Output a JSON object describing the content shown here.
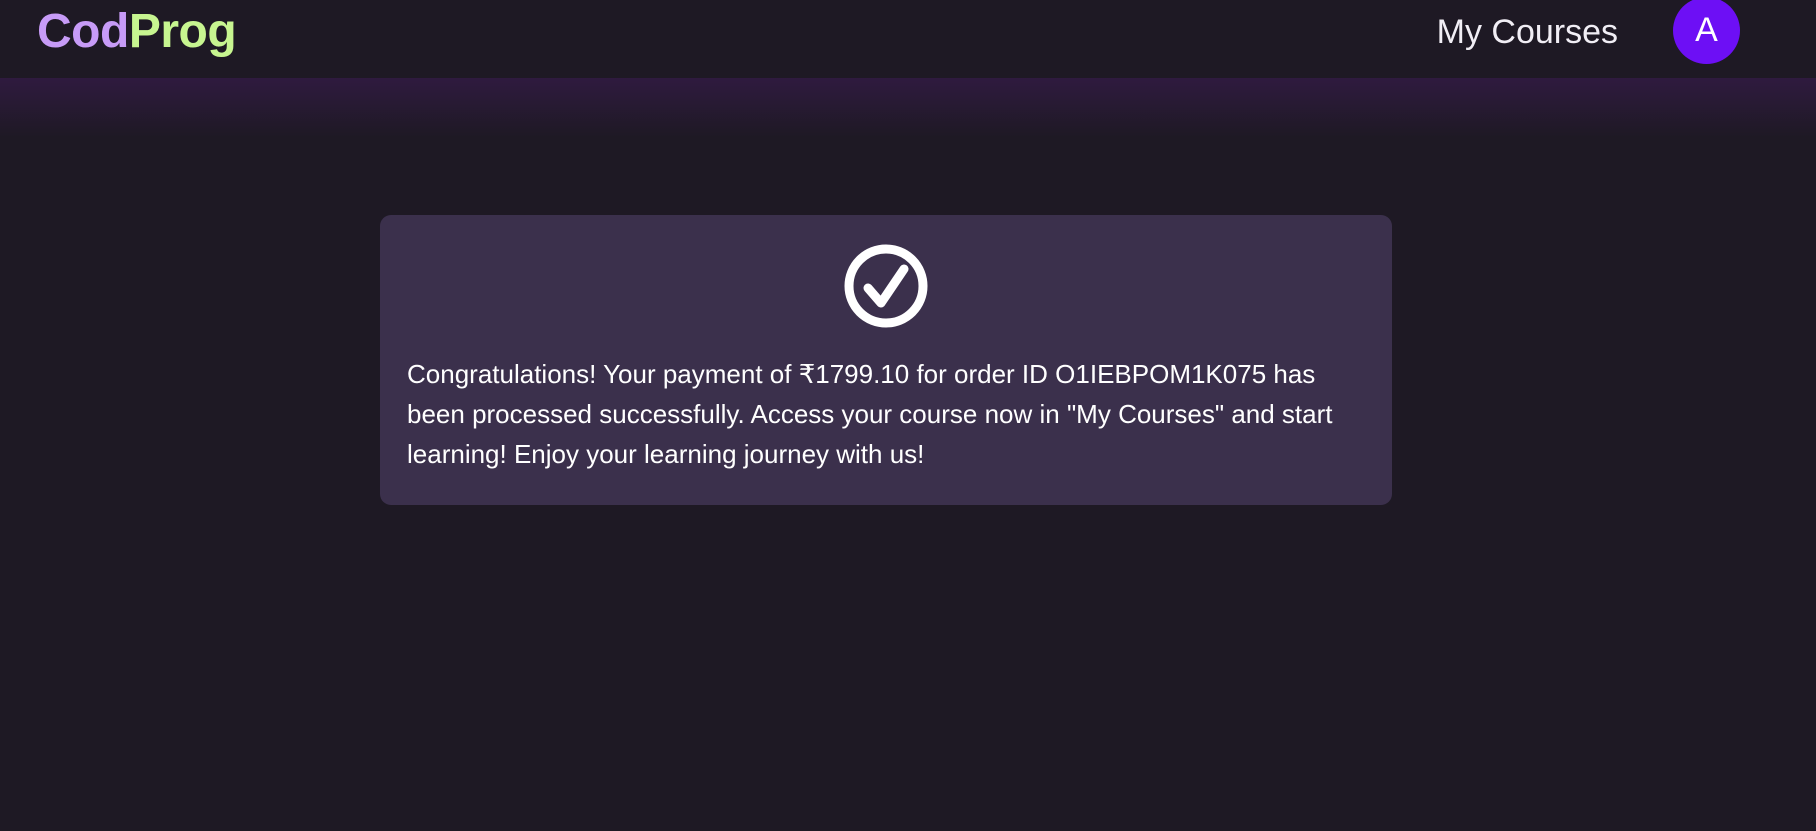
{
  "brand": {
    "part1": "Cod",
    "part2": "Prog",
    "part1_color": "#c79bf7",
    "part2_color": "#c7f590"
  },
  "nav": {
    "my_courses_label": "My Courses",
    "avatar_initial": "A",
    "avatar_color": "#6d0ff5"
  },
  "success_card": {
    "icon": "check-circle-icon",
    "message": "Congratulations! Your payment of ₹1799.10 for order ID O1IEBPOM1K075 has been processed successfully. Access your course now in \"My Courses\" and start learning! Enjoy your learning journey with us!"
  },
  "colors": {
    "background": "#1e1924",
    "card": "#3b304c",
    "text": "#ffffff"
  }
}
